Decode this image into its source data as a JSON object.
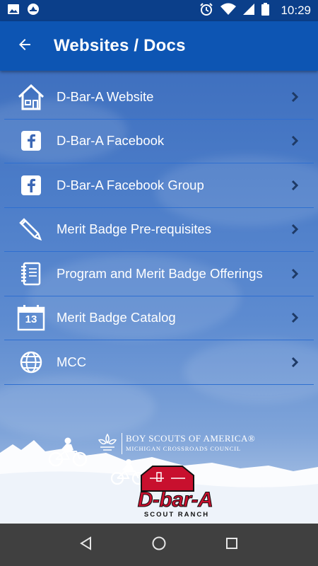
{
  "status_bar": {
    "time": "10:29",
    "left_icons": [
      "image-icon",
      "app-notification-icon"
    ],
    "right_icons": [
      "alarm-icon",
      "wifi-icon",
      "signal-icon",
      "battery-icon"
    ]
  },
  "app_bar": {
    "title": "Websites / Docs",
    "back_icon": "arrow-left-icon"
  },
  "menu": {
    "items": [
      {
        "label": "D-Bar-A Website",
        "icon": "house-icon"
      },
      {
        "label": "D-Bar-A Facebook",
        "icon": "facebook-icon"
      },
      {
        "label": "D-Bar-A Facebook Group",
        "icon": "facebook-icon"
      },
      {
        "label": "Merit Badge Pre-requisites",
        "icon": "pencil-icon"
      },
      {
        "label": "Program and Merit Badge Offerings",
        "icon": "notebook-icon"
      },
      {
        "label": "Merit Badge Catalog",
        "icon": "calendar-icon"
      },
      {
        "label": "MCC",
        "icon": "globe-icon"
      }
    ],
    "calendar_day": "13"
  },
  "footer": {
    "bsa_line1": "BOY SCOUTS OF AMERICA®",
    "bsa_line2": "MICHIGAN CROSSROADS COUNCIL",
    "logo_wordmark": "D-bar-A",
    "logo_sub": "SCOUT RANCH"
  },
  "nav_bar": {
    "buttons": [
      "back-triangle-icon",
      "home-circle-icon",
      "recents-square-icon"
    ]
  },
  "colors": {
    "status_bar": "#0b3f8a",
    "app_bar": "#0d55b3",
    "nav_bar": "#404040",
    "divider": "#2f6fd0",
    "logo_red": "#c8102e"
  }
}
